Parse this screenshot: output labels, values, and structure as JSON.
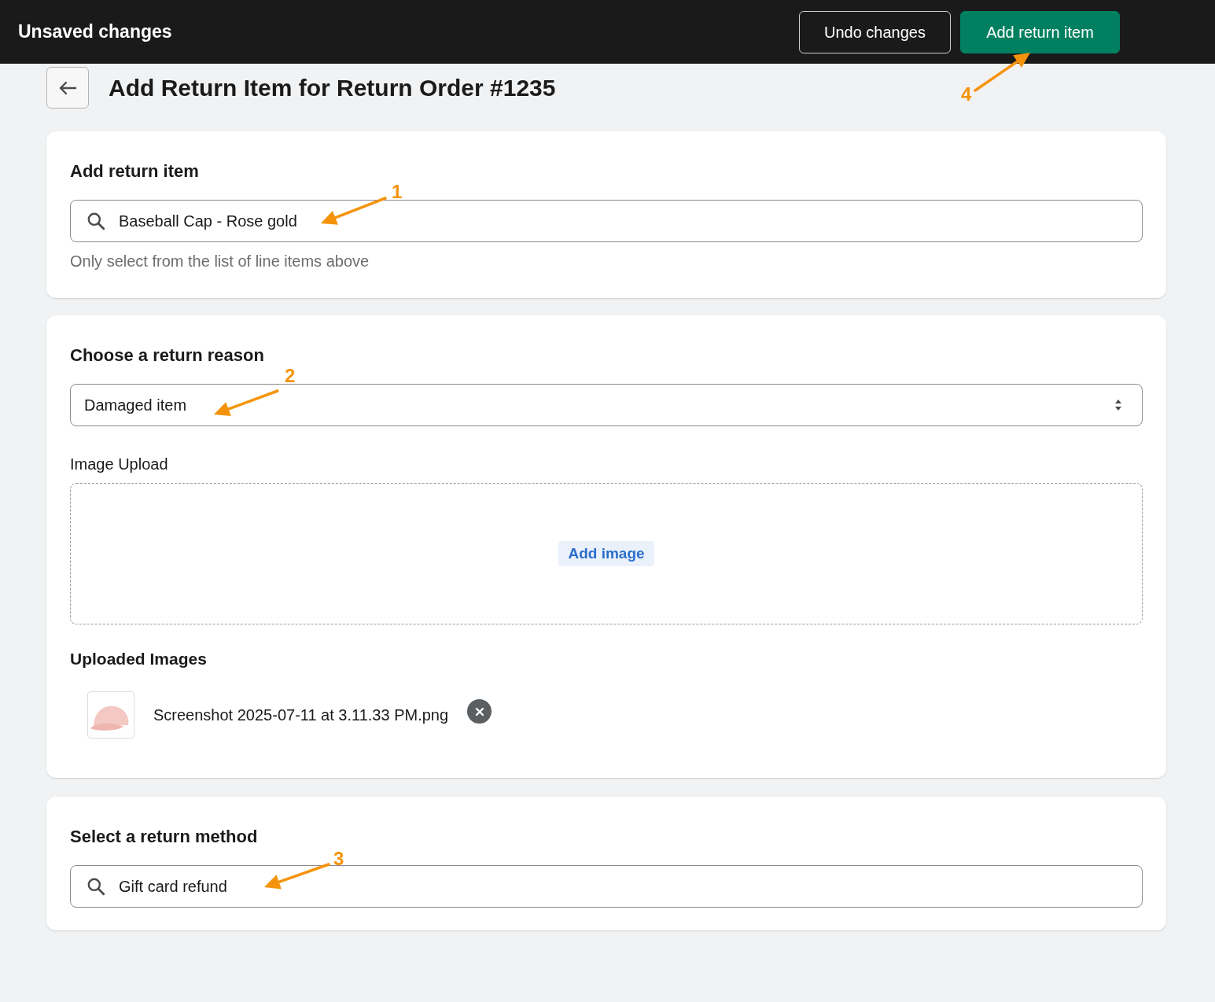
{
  "top_bar": {
    "title": "Unsaved changes",
    "buttons": [
      {
        "label": "Undo changes",
        "kind": "secondary"
      },
      {
        "label": "Add return item",
        "kind": "primary"
      }
    ]
  },
  "page": {
    "title": "Add Return Item for Return Order #1235"
  },
  "item_card": {
    "title": "Add return item",
    "search": {
      "value": "Baseball Cap - Rose gold"
    },
    "help": "Only select from the list of line items above"
  },
  "reason_card": {
    "title": "Choose a return reason",
    "select": {
      "value": "Damaged item"
    },
    "upload_label": "Image Upload",
    "upload_button": "Add image",
    "uploaded_title": "Uploaded Images",
    "uploaded_images": [
      {
        "filename": "Screenshot 2025-07-11 at 3.11.33 PM.png"
      }
    ]
  },
  "method_card": {
    "title": "Select a return method",
    "search": {
      "value": "Gift card refund"
    }
  },
  "annotations": [
    {
      "number": "1"
    },
    {
      "number": "2"
    },
    {
      "number": "3"
    },
    {
      "number": "4"
    }
  ]
}
